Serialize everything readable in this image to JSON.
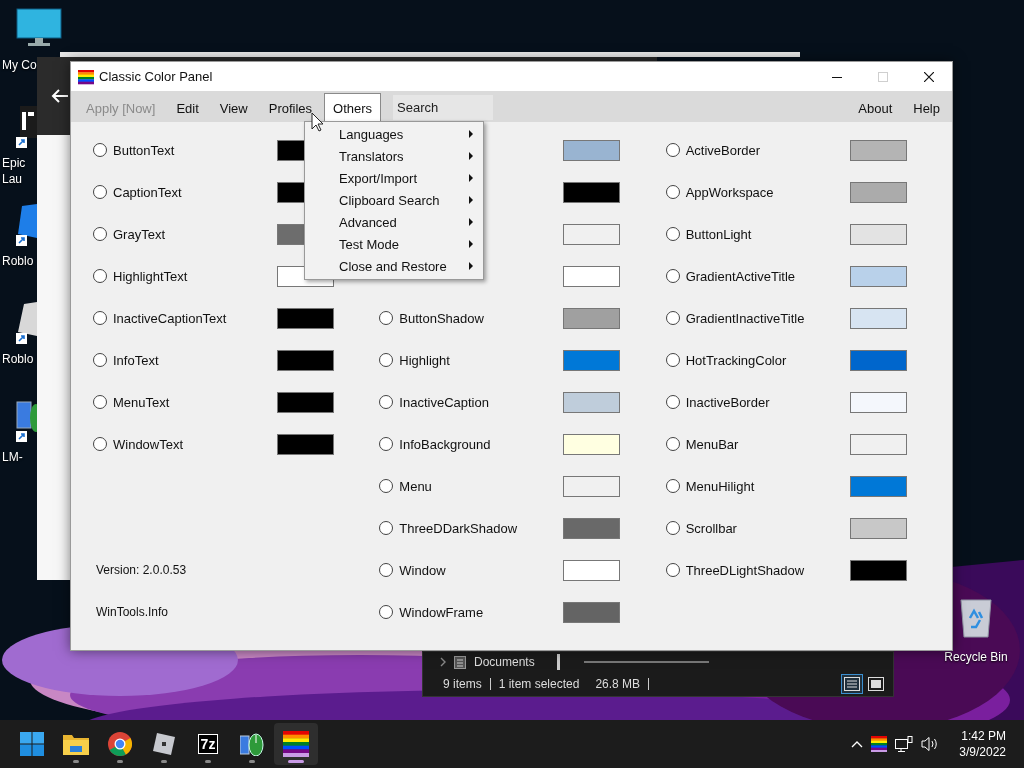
{
  "desktop_icons": [
    {
      "kind": "monitor",
      "lines": [
        "My Co"
      ]
    },
    {
      "kind": "launcher",
      "lines": [
        "Epic",
        "Lau"
      ]
    },
    {
      "kind": "game",
      "lines": [
        "Roblo"
      ]
    },
    {
      "kind": "game_gray",
      "lines": [
        "Roblo"
      ]
    },
    {
      "kind": "monitor_mouse",
      "lines": [
        "LM-"
      ]
    }
  ],
  "recycle_bin": {
    "label": "Recycle Bin"
  },
  "explorer_window": {
    "breadcrumb": "Documents",
    "status": [
      "9 items",
      "1 item selected",
      "26.8 MB"
    ],
    "view_buttons": [
      {
        "kind": "details",
        "selected": true
      },
      {
        "kind": "tiles",
        "selected": false
      }
    ]
  },
  "window": {
    "title": "Classic Color Panel",
    "controls": [
      {
        "kind": "minimize",
        "disabled": false
      },
      {
        "kind": "maximize",
        "disabled": true
      },
      {
        "kind": "close",
        "disabled": false
      }
    ],
    "menu_bar": {
      "items": [
        {
          "label": "Apply [Now]",
          "disabled": true,
          "selected": false
        },
        {
          "label": "Edit",
          "disabled": false,
          "selected": false
        },
        {
          "label": "View",
          "disabled": false,
          "selected": false
        },
        {
          "label": "Profiles",
          "disabled": false,
          "selected": false
        },
        {
          "label": "Others",
          "disabled": false,
          "selected": true
        }
      ],
      "search": {
        "placeholder": "Search"
      },
      "right_items": [
        "About",
        "Help"
      ]
    },
    "color_columns": [
      {
        "rows": [
          {
            "label": "ButtonText",
            "selected": false,
            "color": "#000000"
          },
          {
            "label": "CaptionText",
            "selected": false,
            "color": "#000000"
          },
          {
            "label": "GrayText",
            "selected": false,
            "color": "#6d6d6d"
          },
          {
            "label": "HighlightText",
            "selected": false,
            "color": "#ffffff"
          },
          {
            "label": "InactiveCaptionText",
            "selected": false,
            "color": "#000000"
          },
          {
            "label": "InfoText",
            "selected": false,
            "color": "#000000"
          },
          {
            "label": "MenuText",
            "selected": false,
            "color": "#000000"
          },
          {
            "label": "WindowText",
            "selected": false,
            "color": "#000000"
          }
        ]
      },
      {
        "rows": [
          {
            "color": "#99b4d1"
          },
          {
            "color": "#000000"
          },
          {
            "color": "#f0f0f0"
          },
          {
            "color": "#ffffff"
          },
          {
            "label": "ButtonShadow",
            "selected": false,
            "color": "#a0a0a0"
          },
          {
            "label": "Highlight",
            "selected": false,
            "color": "#0078d7"
          },
          {
            "label": "InactiveCaption",
            "selected": false,
            "color": "#bfcddb"
          },
          {
            "label": "InfoBackground",
            "selected": false,
            "color": "#ffffe1"
          },
          {
            "label": "Menu",
            "selected": false,
            "color": "#f0f0f0"
          },
          {
            "label": "ThreeDDarkShadow",
            "selected": false,
            "color": "#696969"
          },
          {
            "label": "Window",
            "selected": false,
            "color": "#ffffff"
          },
          {
            "label": "WindowFrame",
            "selected": false,
            "color": "#646464"
          }
        ]
      },
      {
        "rows": [
          {
            "label": "ActiveBorder",
            "selected": false,
            "color": "#b4b4b4"
          },
          {
            "label": "AppWorkspace",
            "selected": false,
            "color": "#ababab"
          },
          {
            "label": "ButtonLight",
            "selected": false,
            "color": "#e3e3e3"
          },
          {
            "label": "GradientActiveTitle",
            "selected": false,
            "color": "#b9d1ea"
          },
          {
            "label": "GradientInactiveTitle",
            "selected": false,
            "color": "#d7e4f2"
          },
          {
            "label": "HotTrackingColor",
            "selected": false,
            "color": "#0066cc"
          },
          {
            "label": "InactiveBorder",
            "selected": false,
            "color": "#f4f7fc"
          },
          {
            "label": "MenuBar",
            "selected": false,
            "color": "#f0f0f0"
          },
          {
            "label": "MenuHilight",
            "selected": false,
            "color": "#0078d7"
          },
          {
            "label": "Scrollbar",
            "selected": false,
            "color": "#c8c8c8"
          },
          {
            "label": "ThreeDLightShadow",
            "selected": false,
            "color": "#000000"
          }
        ]
      }
    ],
    "footer": [
      "Version: 2.0.0.53",
      "WinTools.Info"
    ],
    "open_menu": {
      "items": [
        {
          "label": "Languages",
          "submenu": true
        },
        {
          "label": "Translators",
          "submenu": true
        },
        {
          "label": "Export/Import",
          "submenu": true
        },
        {
          "label": "Clipboard Search",
          "submenu": true
        },
        {
          "label": "Advanced",
          "submenu": true
        },
        {
          "label": "Test Mode",
          "submenu": true
        },
        {
          "label": "Close and Restore",
          "submenu": true
        }
      ]
    }
  },
  "taskbar": {
    "apps": [
      {
        "kind": "start",
        "running": false,
        "selected": false
      },
      {
        "kind": "folder",
        "running": true,
        "selected": false
      },
      {
        "kind": "browser",
        "running": true,
        "selected": false
      },
      {
        "kind": "game",
        "running": true,
        "selected": false
      },
      {
        "kind": "archiver",
        "label": "7z",
        "running": true,
        "selected": false
      },
      {
        "kind": "mouse",
        "running": true,
        "selected": false
      },
      {
        "kind": "rainbow",
        "running": true,
        "selected": true
      }
    ],
    "tray": [
      {
        "kind": "chevron"
      },
      {
        "kind": "rainbow"
      },
      {
        "kind": "network"
      },
      {
        "kind": "volume"
      }
    ],
    "time": "1:42 PM",
    "date": "3/9/2022"
  }
}
